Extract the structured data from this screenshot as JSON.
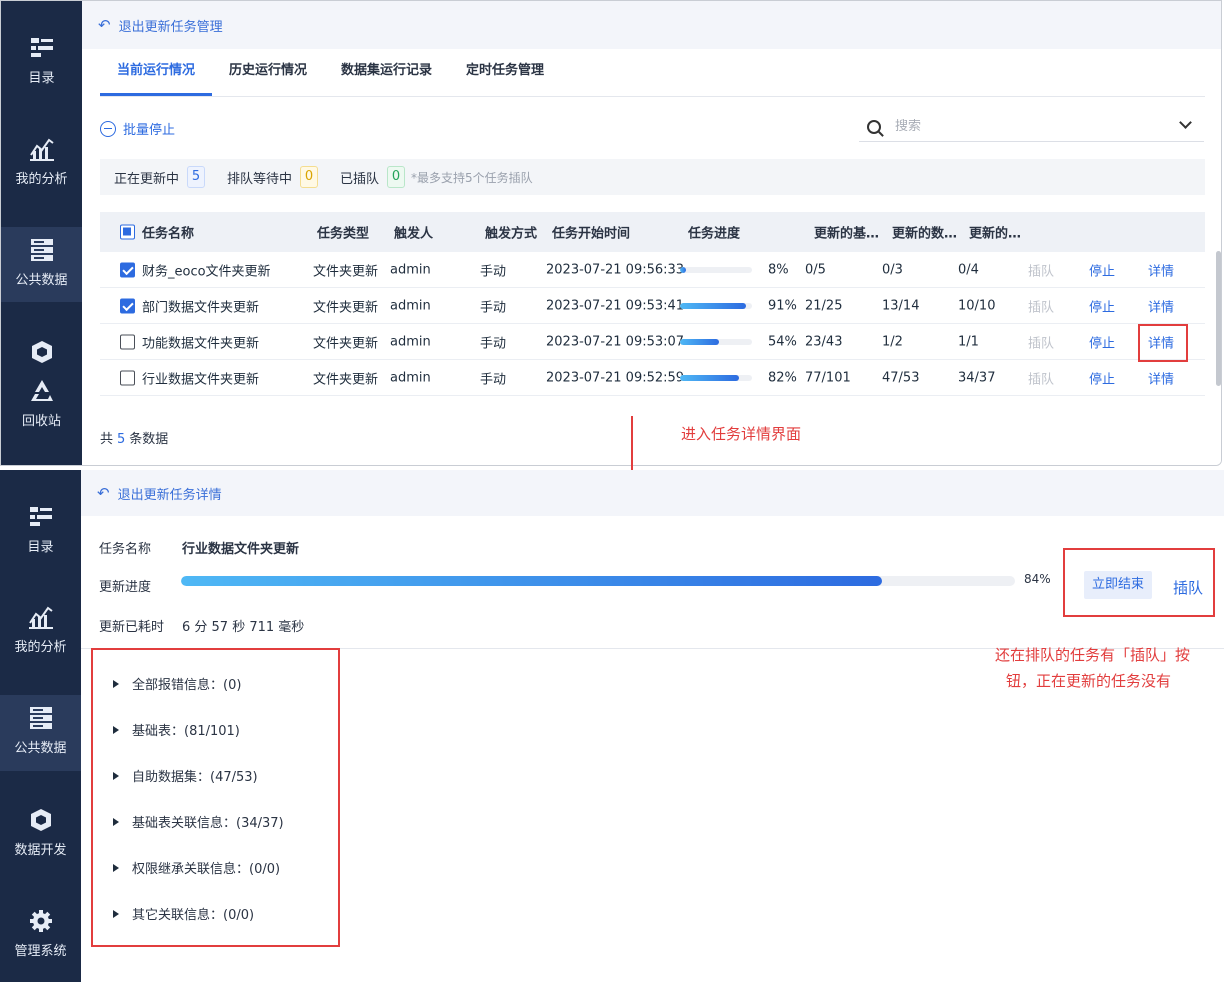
{
  "colors": {
    "sidebar_bg": "#1b2a46",
    "accent": "#2d6be0",
    "annotation": "#e23d3d"
  },
  "top_screen": {
    "sidebar": [
      {
        "icon": "catalog-icon",
        "label": "目录"
      },
      {
        "icon": "analysis-icon",
        "label": "我的分析"
      },
      {
        "icon": "public-data-icon",
        "label": "公共数据"
      },
      {
        "icon": "cube-icon",
        "label": ""
      },
      {
        "icon": "recycle-icon",
        "label": "回收站"
      }
    ],
    "back_link": "退出更新任务管理",
    "tabs": [
      "当前运行情况",
      "历史运行情况",
      "数据集运行记录",
      "定时任务管理"
    ],
    "batch_stop": "批量停止",
    "search_placeholder": "搜索",
    "status": {
      "updating_label": "正在更新中",
      "updating_count": "5",
      "queued_label": "排队等待中",
      "queued_count": "0",
      "inserted_label": "已插队",
      "inserted_count": "0",
      "note": "*最多支持5个任务插队"
    },
    "table": {
      "headers": [
        "任务名称",
        "任务类型",
        "触发人",
        "触发方式",
        "任务开始时间",
        "任务进度",
        "更新的基…",
        "更新的数…",
        "更新的…"
      ],
      "rows": [
        {
          "checked": true,
          "name": "财务_eoco文件夹更新",
          "type": "文件夹更新",
          "user": "admin",
          "trigger": "手动",
          "start": "2023-07-21 09:56:33",
          "progress": 8,
          "progress_label": "8%",
          "base": "0/5",
          "dataset": "0/3",
          "other": "0/4",
          "insert": "插队",
          "stop": "停止",
          "detail": "详情"
        },
        {
          "checked": true,
          "name": "部门数据文件夹更新",
          "type": "文件夹更新",
          "user": "admin",
          "trigger": "手动",
          "start": "2023-07-21 09:53:41",
          "progress": 91,
          "progress_label": "91%",
          "base": "21/25",
          "dataset": "13/14",
          "other": "10/10",
          "insert": "插队",
          "stop": "停止",
          "detail": "详情"
        },
        {
          "checked": false,
          "name": "功能数据文件夹更新",
          "type": "文件夹更新",
          "user": "admin",
          "trigger": "手动",
          "start": "2023-07-21 09:53:07",
          "progress": 54,
          "progress_label": "54%",
          "base": "23/43",
          "dataset": "1/2",
          "other": "1/1",
          "insert": "插队",
          "stop": "停止",
          "detail": "详情"
        },
        {
          "checked": false,
          "name": "行业数据文件夹更新",
          "type": "文件夹更新",
          "user": "admin",
          "trigger": "手动",
          "start": "2023-07-21 09:52:59",
          "progress": 82,
          "progress_label": "82%",
          "base": "77/101",
          "dataset": "47/53",
          "other": "34/37",
          "insert": "插队",
          "stop": "停止",
          "detail": "详情"
        }
      ]
    },
    "total_prefix": "共",
    "total_count": "5",
    "total_suffix": "条数据"
  },
  "annotations": {
    "enter_detail": "进入任务详情界面",
    "queue_note_line1": "还在排队的任务有「插队」按",
    "queue_note_line2": "钮，正在更新的任务没有"
  },
  "bottom_screen": {
    "sidebar": [
      {
        "icon": "catalog-icon",
        "label": "目录"
      },
      {
        "icon": "analysis-icon",
        "label": "我的分析"
      },
      {
        "icon": "public-data-icon",
        "label": "公共数据"
      },
      {
        "icon": "cube-icon",
        "label": "数据开发"
      },
      {
        "icon": "gear-icon",
        "label": "管理系统"
      }
    ],
    "back_link": "退出更新任务详情",
    "task_name_label": "任务名称",
    "task_name": "行业数据文件夹更新",
    "progress_label": "更新进度",
    "progress": 84,
    "progress_text": "84%",
    "end_now": "立即结束",
    "insert": "插队",
    "elapsed_label": "更新已耗时",
    "elapsed": "6 分 57 秒 711 毫秒",
    "tree": [
      "全部报错信息：(0)",
      "基础表：(81/101)",
      "自助数据集：(47/53)",
      "基础表关联信息：(34/37)",
      "权限继承关联信息：(0/0)",
      "其它关联信息：(0/0)"
    ]
  }
}
